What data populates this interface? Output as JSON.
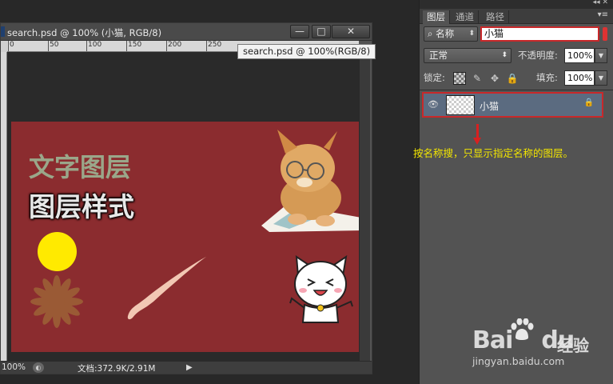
{
  "document": {
    "title": "search.psd @ 100% (小猫, RGB/8)",
    "zoom": "100%",
    "doc_size": "文档:372.9K/2.91M",
    "ruler_ticks": [
      "0",
      "50",
      "100",
      "150",
      "200",
      "250"
    ],
    "window_buttons": {
      "minimize": "—",
      "maximize": "□",
      "close": "✕"
    }
  },
  "tooltip": "search.psd @ 100%(RGB/8)",
  "canvas": {
    "background": "#8b2c2f",
    "text_layer": "文字图层",
    "style_layer": "图层样式"
  },
  "layers_panel": {
    "tabs": [
      "图层",
      "通道",
      "路径"
    ],
    "active_tab": "图层",
    "filter_kind": "名称",
    "search_value": "小猫",
    "blend_mode": "正常",
    "opacity_label": "不透明度:",
    "opacity_value": "100%",
    "lock_label": "锁定:",
    "fill_label": "填充:",
    "fill_value": "100%",
    "layers": [
      {
        "name": "小猫",
        "visible": true,
        "locked": true
      }
    ]
  },
  "annotation": "按名称搜，只显示指定名称的图层。",
  "watermark": {
    "logo": "Bai",
    "logo_tail": "du",
    "cn": "经验",
    "url": "jingyan.baidu.com"
  }
}
